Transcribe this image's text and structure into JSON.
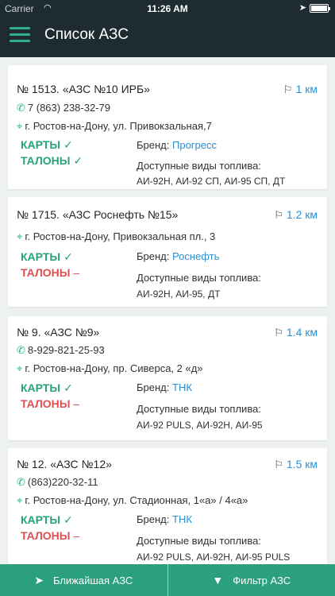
{
  "status_bar": {
    "carrier": "Carrier",
    "time": "11:26 AM"
  },
  "header": {
    "title": "Список АЗС"
  },
  "stations": [
    {
      "name": "№ 1513. «АЗС №10 ИРБ»",
      "distance": "1 км",
      "phone": "7 (863) 238-32-79",
      "address": "г. Ростов-на-Дону, ул. Привокзальная,7",
      "cards_label": "КАРТЫ",
      "cards_mark": "✓",
      "coupons_label": "ТАЛОНЫ",
      "coupons_mark": "✓",
      "brand_label": "Бренд:",
      "brand": "Прогресс",
      "fuel_label": "Доступные виды топлива:",
      "fuels": "АИ-92Н, АИ-92 СП, АИ-95 СП, ДТ"
    },
    {
      "name": "№ 1715. «АЗС Роснефть №15»",
      "distance": "1.2 км",
      "address": "г. Ростов-на-Дону, Привокзальная пл., 3",
      "cards_label": "КАРТЫ",
      "cards_mark": "✓",
      "coupons_label": "ТАЛОНЫ",
      "coupons_mark": "–",
      "brand_label": "Бренд:",
      "brand": "Роснефть",
      "fuel_label": "Доступные виды топлива:",
      "fuels": "АИ-92Н, АИ-95, ДТ"
    },
    {
      "name": "№ 9. «АЗС №9»",
      "distance": "1.4 км",
      "phone": "8-929-821-25-93",
      "address": "г. Ростов-на-Дону, пр. Сиверса, 2 «д»",
      "cards_label": "КАРТЫ",
      "cards_mark": "✓",
      "coupons_label": "ТАЛОНЫ",
      "coupons_mark": "–",
      "brand_label": "Бренд:",
      "brand": "ТНК",
      "fuel_label": "Доступные виды топлива:",
      "fuels": "АИ-92 PULS, АИ-92Н, АИ-95"
    },
    {
      "name": "№ 12. «АЗС №12»",
      "distance": "1.5 км",
      "phone": "(863)220-32-11",
      "address": "г. Ростов-на-Дону, ул. Стадионная, 1«а» / 4«а»",
      "cards_label": "КАРТЫ",
      "cards_mark": "✓",
      "coupons_label": "ТАЛОНЫ",
      "coupons_mark": "–",
      "brand_label": "Бренд:",
      "brand": "ТНК",
      "fuel_label": "Доступные виды топлива:",
      "fuels": "АИ-92 PULS, АИ-92Н, АИ-95 PULS"
    }
  ],
  "bottom_bar": {
    "nearest_label": "Ближайшая АЗС",
    "filter_label": "Фильтр АЗС"
  },
  "icons": {
    "phone": "phone-icon",
    "pin": "map-pin-icon",
    "distance": "signpost-icon",
    "menu": "hamburger-menu-icon",
    "nearest": "navigation-arrow-icon",
    "filter": "funnel-filter-icon"
  },
  "colors": {
    "header": "#1e2c32",
    "accent_green": "#2aa07c",
    "ok": "#27a27d",
    "no": "#e04e4e",
    "link_blue": "#2d8fd0"
  }
}
